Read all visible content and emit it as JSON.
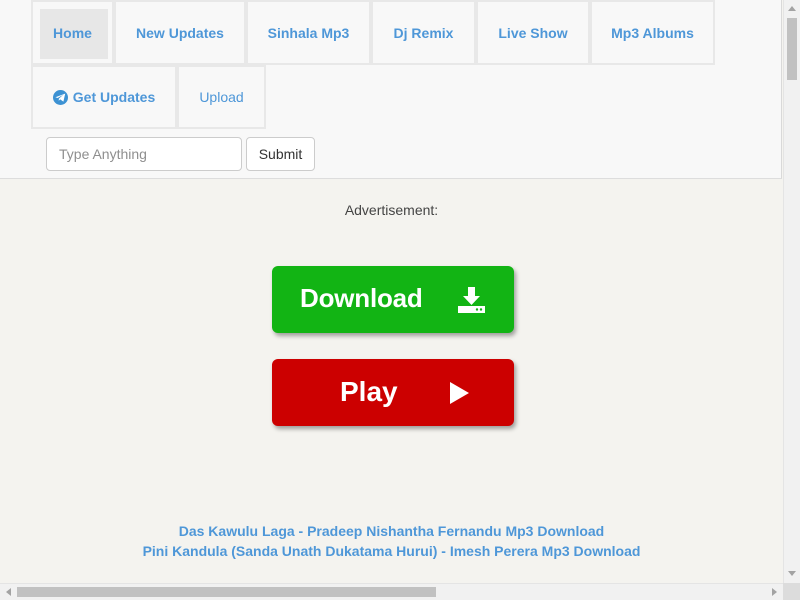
{
  "nav": {
    "items": [
      {
        "label": "Home"
      },
      {
        "label": "New Updates"
      },
      {
        "label": "Sinhala Mp3"
      },
      {
        "label": "Dj Remix"
      },
      {
        "label": "Live Show"
      },
      {
        "label": "Mp3 Albums"
      },
      {
        "label": "Get Updates",
        "icon": "telegram-icon"
      },
      {
        "label": "Upload"
      }
    ]
  },
  "search": {
    "placeholder": "Type Anything",
    "value": "",
    "submit_label": "Submit"
  },
  "ad": {
    "label": "Advertisement:"
  },
  "actions": {
    "download_label": "Download",
    "download_icon": "download-icon",
    "play_label": "Play",
    "play_icon": "play-icon"
  },
  "songs": [
    {
      "title": "Das Kawulu Laga - Pradeep Nishantha Fernandu Mp3 Download"
    },
    {
      "title": "Pini Kandula (Sanda Unath Dukatama Hurui) - Imesh Perera Mp3 Download"
    }
  ],
  "colors": {
    "link": "#4e97d8",
    "download": "#12b414",
    "play": "#cc0000",
    "page_background": "#f4f3ef"
  }
}
